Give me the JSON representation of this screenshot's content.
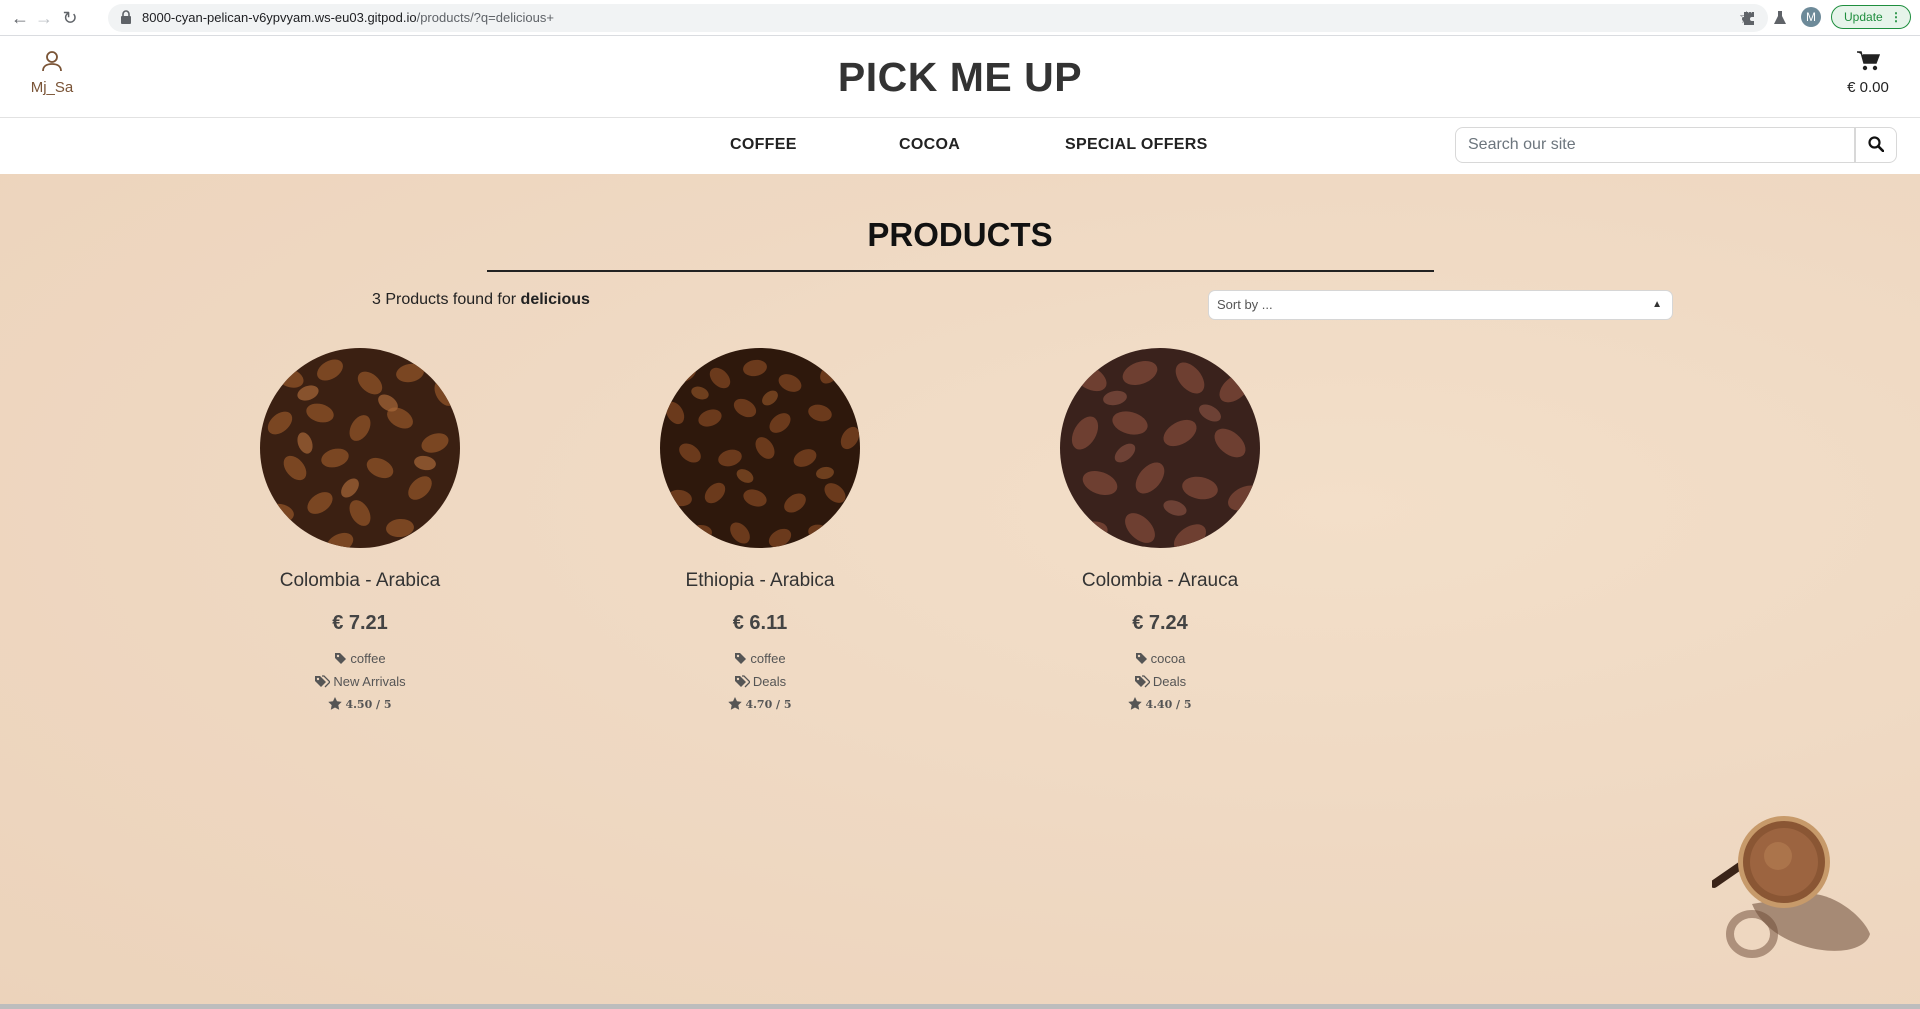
{
  "browser": {
    "url_host": "8000-cyan-pelican-v6ypvyam.ws-eu03.gitpod.io",
    "url_rest": "/products/?q=delicious+",
    "profile_initial": "M",
    "update_label": "Update"
  },
  "header": {
    "account_label": "Mj_Sa",
    "logo": "PICK ME UP",
    "bag_total": "€ 0.00"
  },
  "nav": {
    "items": [
      "COFFEE",
      "COCOA",
      "SPECIAL OFFERS"
    ],
    "search_placeholder": "Search our site"
  },
  "main": {
    "title": "PRODUCTS",
    "results_prefix": "3 Products found for",
    "query": "delicious",
    "sort_label": "Sort by ..."
  },
  "products": [
    {
      "name": "Colombia - Arabica",
      "price": "€ 7.21",
      "category": "coffee",
      "tag": "New Arrivals",
      "rating": "4.50 / 5",
      "image": "coffee-beans"
    },
    {
      "name": "Ethiopia - Arabica",
      "price": "€ 6.11",
      "category": "coffee",
      "tag": "Deals",
      "rating": "4.70 / 5",
      "image": "coffee-beans"
    },
    {
      "name": "Colombia - Arauca",
      "price": "€ 7.24",
      "category": "cocoa",
      "tag": "Deals",
      "rating": "4.40 / 5",
      "image": "cocoa-beans"
    }
  ],
  "colors": {
    "accent": "#7a5436",
    "background": "#f3e1cd"
  }
}
